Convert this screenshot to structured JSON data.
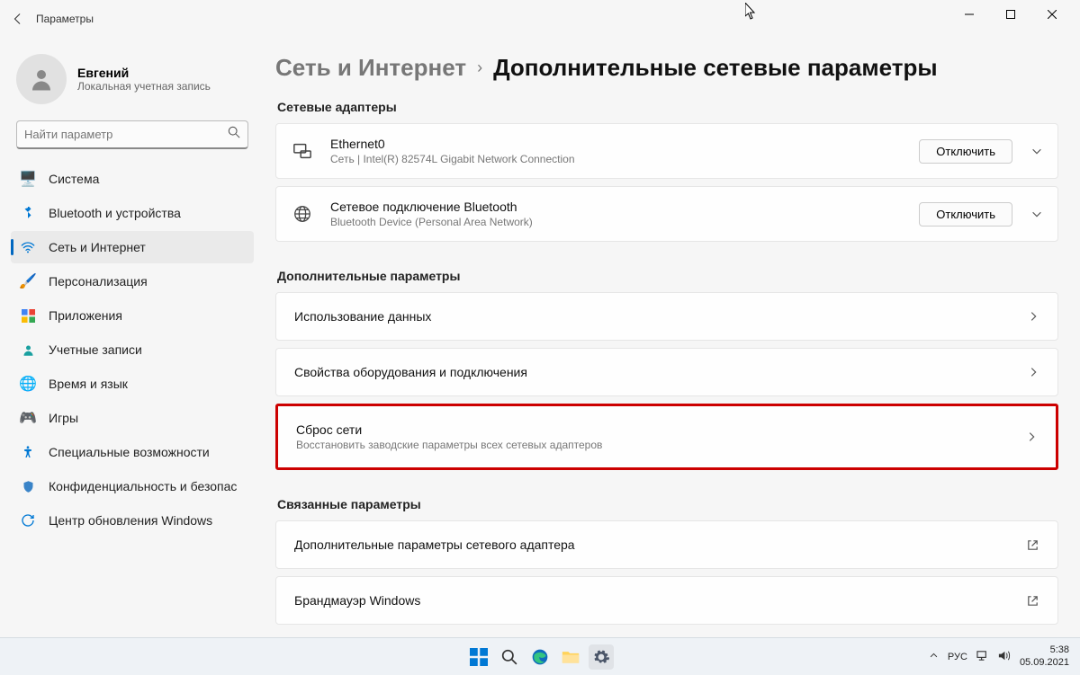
{
  "window": {
    "title": "Параметры"
  },
  "profile": {
    "name": "Евгений",
    "sub": "Локальная учетная запись"
  },
  "search": {
    "placeholder": "Найти параметр"
  },
  "nav": {
    "system": "Система",
    "bluetooth": "Bluetooth и устройства",
    "network": "Сеть и Интернет",
    "personalization": "Персонализация",
    "apps": "Приложения",
    "accounts": "Учетные записи",
    "timelang": "Время и язык",
    "gaming": "Игры",
    "accessibility": "Специальные возможности",
    "privacy": "Конфиденциальность и безопас",
    "update": "Центр обновления Windows"
  },
  "breadcrumb": {
    "parent": "Сеть и Интернет",
    "current": "Дополнительные сетевые параметры"
  },
  "sections": {
    "adapters": "Сетевые адаптеры",
    "additional": "Дополнительные параметры",
    "related": "Связанные параметры"
  },
  "adapters": {
    "eth": {
      "title": "Ethernet0",
      "sub": "Сеть | Intel(R) 82574L Gigabit Network Connection",
      "btn": "Отключить"
    },
    "bt": {
      "title": "Сетевое подключение Bluetooth",
      "sub": "Bluetooth Device (Personal Area Network)",
      "btn": "Отключить"
    }
  },
  "additional": {
    "usage": "Использование данных",
    "hwprops": "Свойства оборудования и подключения",
    "reset": {
      "title": "Сброс сети",
      "sub": "Восстановить заводские параметры всех сетевых адаптеров"
    }
  },
  "related": {
    "adapterOpts": "Дополнительные параметры сетевого адаптера",
    "firewall": "Брандмауэр Windows"
  },
  "taskbar": {
    "lang": "РУС",
    "time": "5:38",
    "date": "05.09.2021"
  }
}
